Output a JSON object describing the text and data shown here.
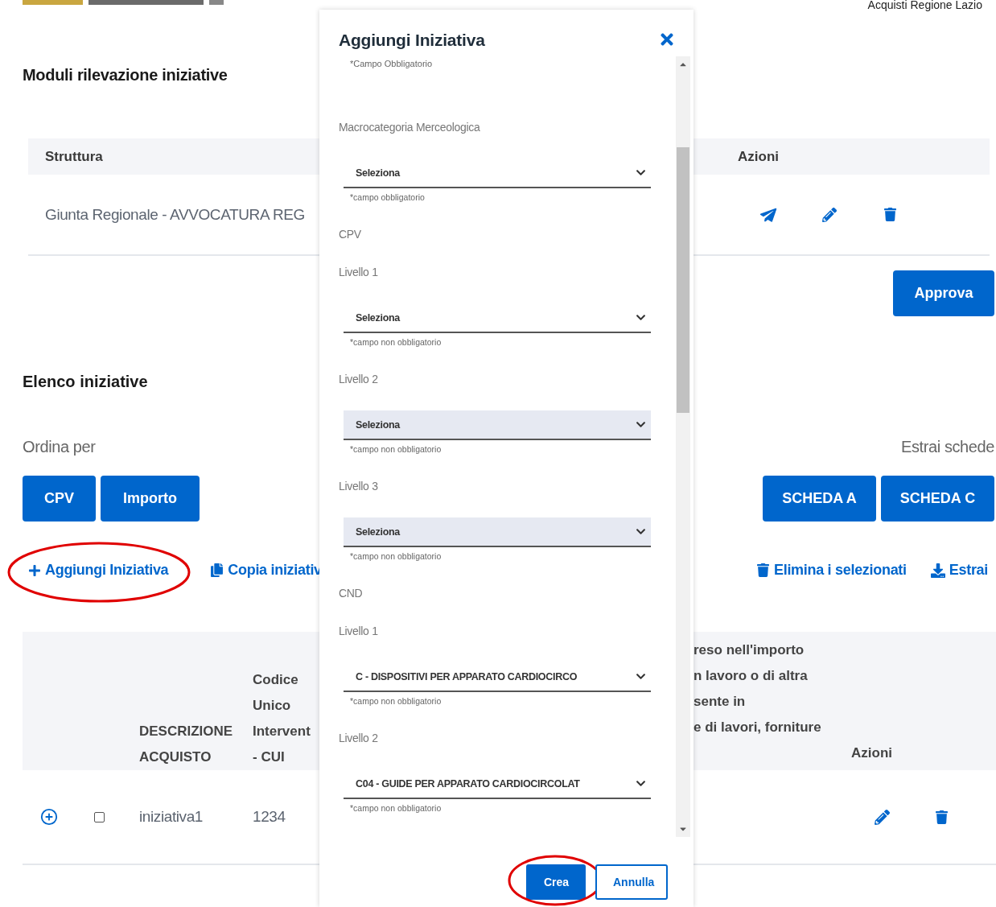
{
  "header": {
    "site_name": "Acquisti Regione Lazio"
  },
  "page_title": "Moduli rilevazione iniziative",
  "moduli_table": {
    "columns": [
      "Struttura",
      "Azioni"
    ],
    "rows": [
      {
        "struttura": "Giunta Regionale - AVVOCATURA REG"
      }
    ]
  },
  "approve_button": "Approva",
  "list_title": "Elenco iniziative",
  "sort": {
    "label": "Ordina per",
    "buttons": [
      "CPV",
      "Importo"
    ]
  },
  "export": {
    "label": "Estrai schede",
    "buttons": [
      "SCHEDA A",
      "SCHEDA C"
    ]
  },
  "actions_left": [
    {
      "kind": "add",
      "label": "Aggiungi Iniziativa",
      "highlighted": true
    },
    {
      "kind": "copy",
      "label": "Copia iniziativ",
      "highlighted": false
    }
  ],
  "actions_right": [
    {
      "kind": "delete",
      "label": "Elimina i selezionati"
    },
    {
      "kind": "download",
      "label": "Estrai"
    }
  ],
  "initiatives_table": {
    "columns_left": [
      [
        "DESCRIZIONE",
        "ACQUISTO"
      ],
      [
        "Codice",
        "Unico",
        "Intervent",
        "- CUI"
      ]
    ],
    "column_right": [
      "reso nell'importo",
      "n lavoro o di altra",
      "sente in",
      "e di lavori, forniture"
    ],
    "actions_column": "Azioni",
    "rows": [
      {
        "descrizione": "iniziativa1",
        "cui": "1234",
        "checked": false,
        "expanded": false
      }
    ]
  },
  "dialog": {
    "title": "Aggiungi Iniziativa",
    "subtitle": "*Campo Obbligatorio",
    "fields": [
      {
        "kind": "select",
        "label": "Macrocategoria Merceologica",
        "value": "Seleziona",
        "hint": "*campo obbligatorio",
        "disabled": false
      },
      {
        "kind": "heading",
        "label": "CPV"
      },
      {
        "kind": "select",
        "label": "Livello 1",
        "value": "Seleziona",
        "hint": "*campo non obbligatorio",
        "disabled": false
      },
      {
        "kind": "select",
        "label": "Livello 2",
        "value": "Seleziona",
        "hint": "*campo non obbligatorio",
        "disabled": true
      },
      {
        "kind": "select",
        "label": "Livello 3",
        "value": "Seleziona",
        "hint": "*campo non obbligatorio",
        "disabled": true
      },
      {
        "kind": "heading",
        "label": "CND"
      },
      {
        "kind": "select",
        "label": "Livello 1",
        "value": "C - DISPOSITIVI PER APPARATO CARDIOCIRCO",
        "hint": "*campo non obbligatorio",
        "disabled": false
      },
      {
        "kind": "select",
        "label": "Livello 2",
        "value": "C04 - GUIDE PER APPARATO CARDIOCIRCOLAT",
        "hint": "*campo non obbligatorio",
        "disabled": false
      }
    ],
    "buttons": [
      {
        "kind": "primary",
        "label": "Crea",
        "highlighted": true
      },
      {
        "kind": "secondary",
        "label": "Annulla",
        "highlighted": false
      }
    ]
  }
}
